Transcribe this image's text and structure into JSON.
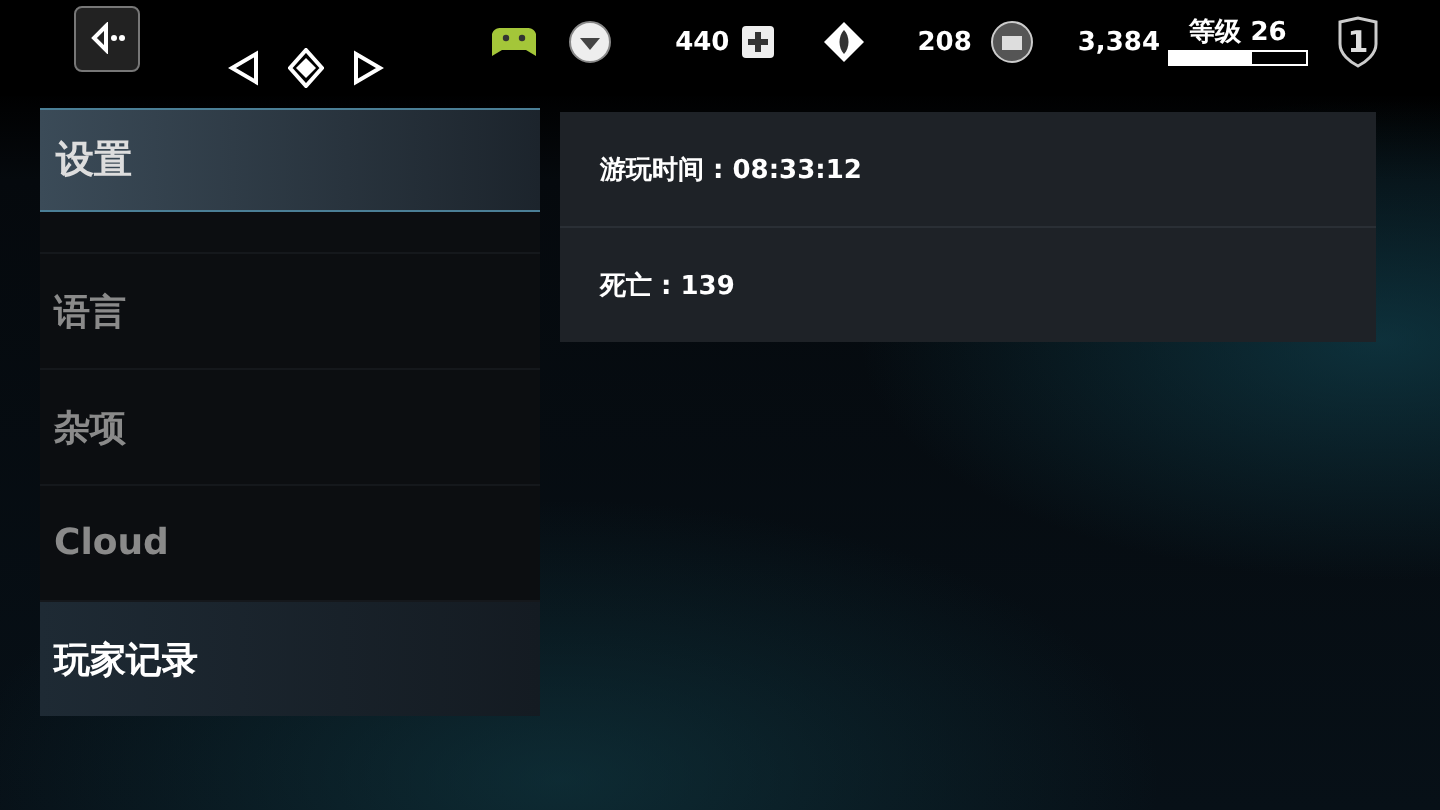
{
  "top_bar": {
    "currencies": [
      {
        "value": "440"
      },
      {
        "value": "208"
      },
      {
        "value": "3,384"
      }
    ],
    "level": {
      "label": "等级 26",
      "level": 0.6
    },
    "rank": "1"
  },
  "menu": {
    "title": "设置",
    "items": [
      {
        "label": "语言",
        "selected": false
      },
      {
        "label": "杂项",
        "selected": false
      },
      {
        "label": "Cloud",
        "selected": false
      },
      {
        "label": "玩家记录",
        "selected": true
      }
    ]
  },
  "stats": [
    {
      "text": "游玩时间 : 08:33:12"
    },
    {
      "text": "死亡 : 139"
    }
  ]
}
